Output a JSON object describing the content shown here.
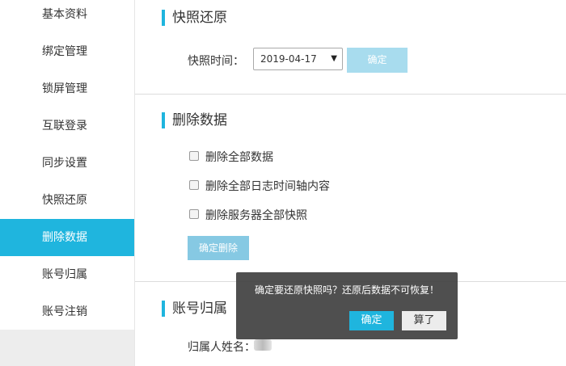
{
  "sidebar": {
    "items": [
      {
        "label": "基本资料",
        "active": false
      },
      {
        "label": "绑定管理",
        "active": false
      },
      {
        "label": "锁屏管理",
        "active": false
      },
      {
        "label": "互联登录",
        "active": false
      },
      {
        "label": "同步设置",
        "active": false
      },
      {
        "label": "快照还原",
        "active": false
      },
      {
        "label": "删除数据",
        "active": true
      },
      {
        "label": "账号归属",
        "active": false
      },
      {
        "label": "账号注销",
        "active": false
      }
    ]
  },
  "snapshot": {
    "title": "快照还原",
    "time_label": "快照时间：",
    "selected_date": "2019-04-17",
    "confirm_label": "确定"
  },
  "delete_data": {
    "title": "删除数据",
    "options": [
      {
        "label": "删除全部数据",
        "checked": false
      },
      {
        "label": "删除全部日志时间轴内容",
        "checked": false
      },
      {
        "label": "删除服务器全部快照",
        "checked": false
      }
    ],
    "confirm_delete_label": "确定删除"
  },
  "ownership": {
    "title": "账号归属",
    "owner_name_label": "归属人姓名："
  },
  "dialog": {
    "message": "确定要还原快照吗？还原后数据不可恢复！",
    "ok_label": "确定",
    "cancel_label": "算了"
  },
  "colors": {
    "accent": "#1fb5de",
    "dialog_bg": "#404040"
  }
}
